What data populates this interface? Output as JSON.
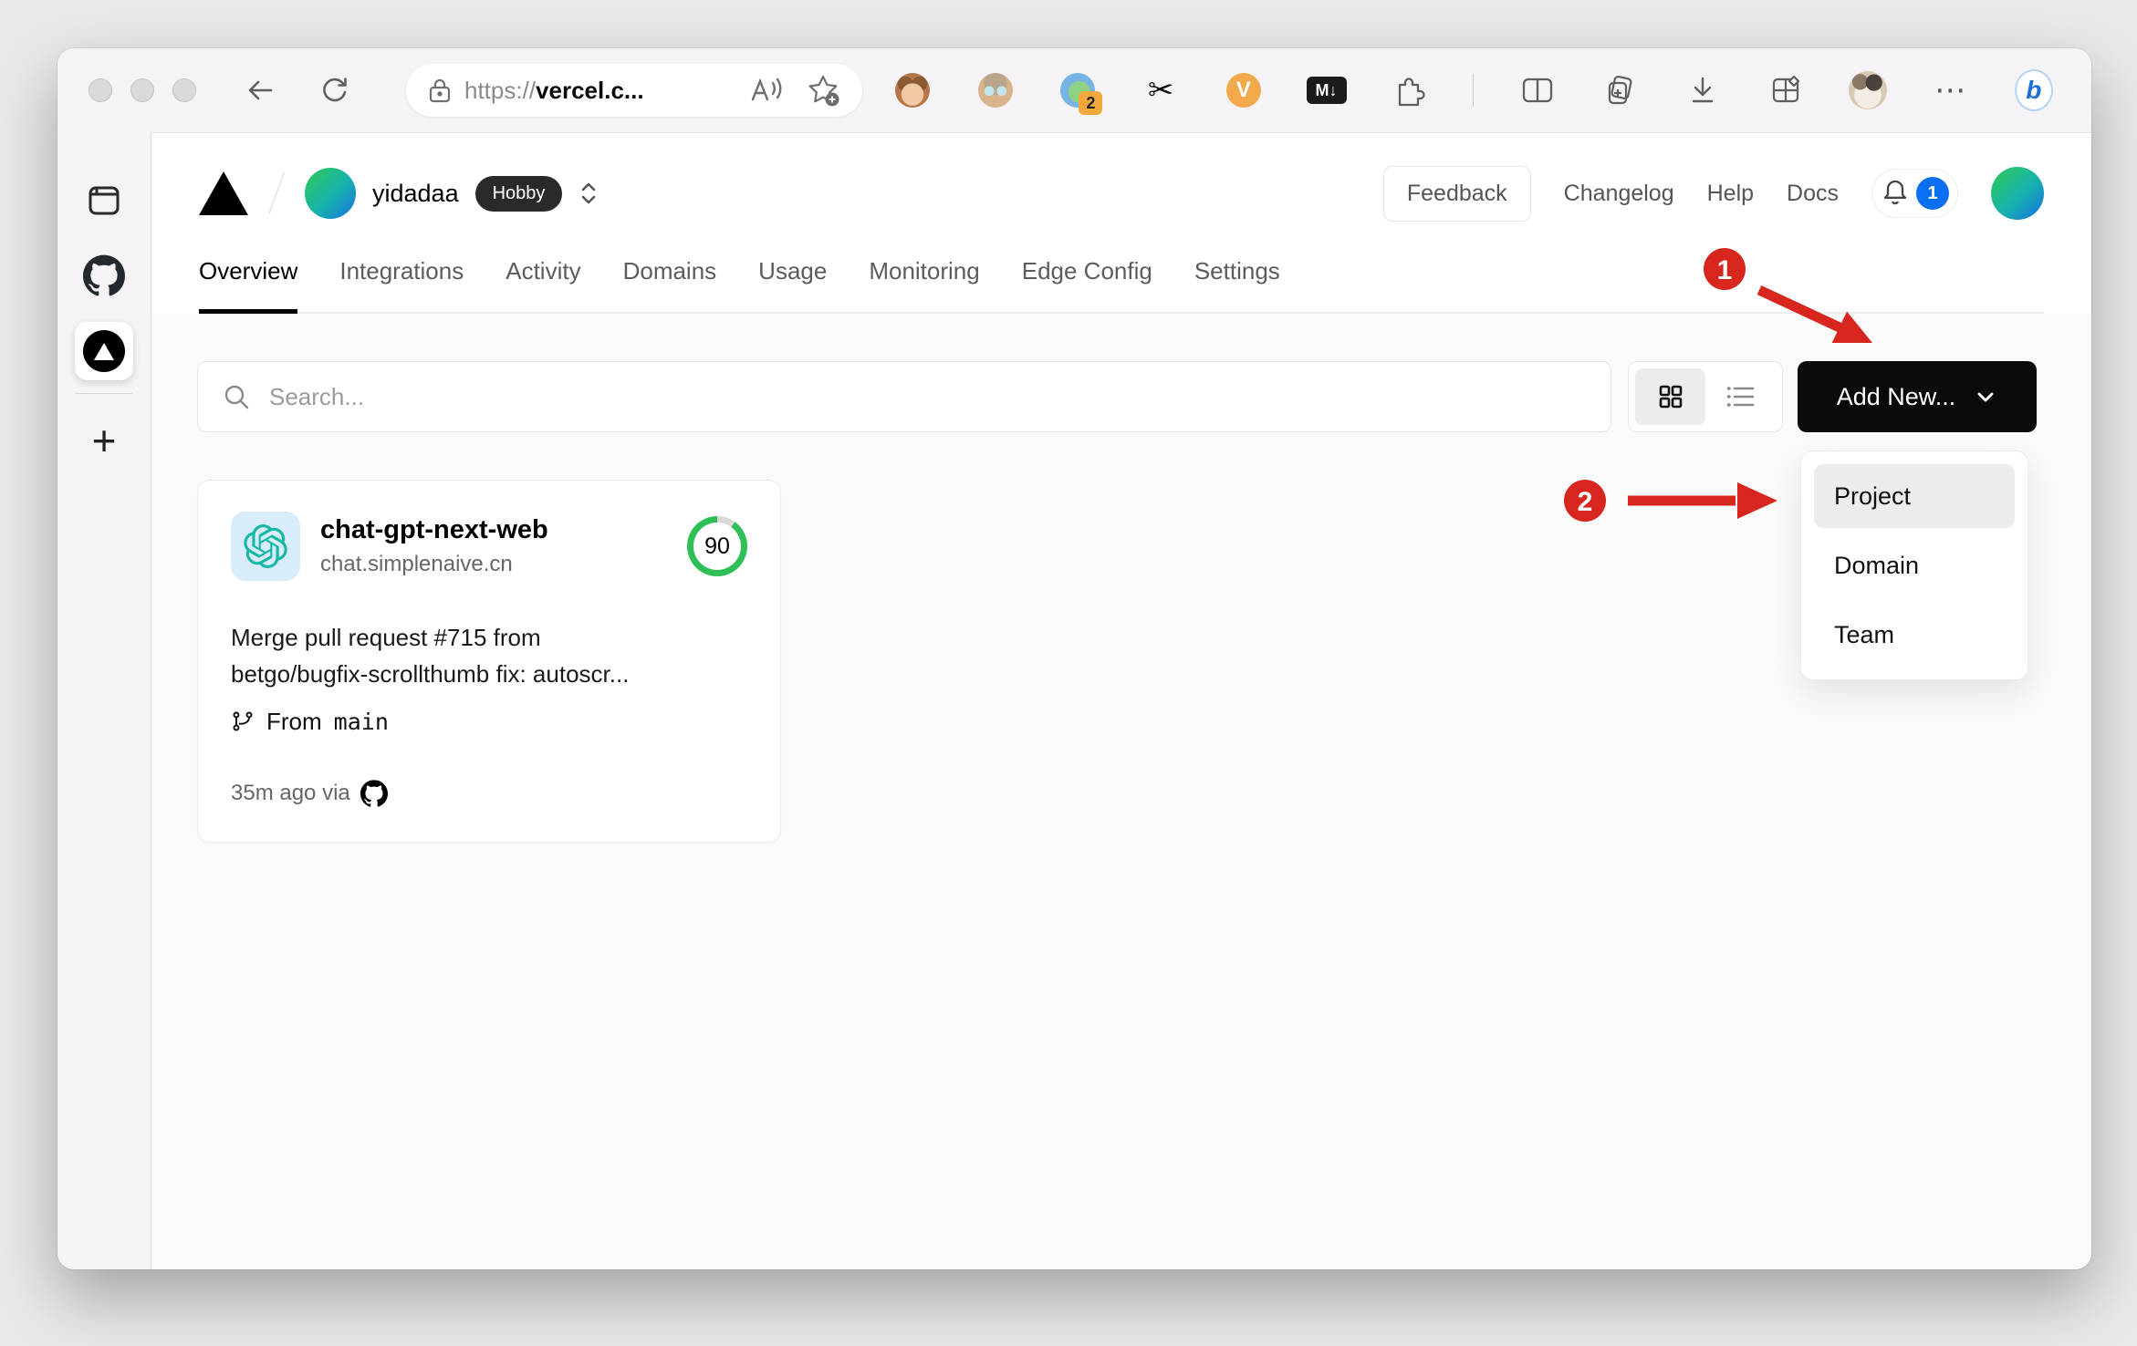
{
  "browser": {
    "url_scheme": "https://",
    "url_host": "vercel.c...",
    "extension_badge": "2"
  },
  "icons": {
    "scissors": "✂",
    "dots": "⋯",
    "v_label": "V",
    "markdown_label": "M↓",
    "plus": "+",
    "bing_label": "b"
  },
  "header": {
    "team": "yidadaa",
    "plan_badge": "Hobby",
    "feedback_label": "Feedback",
    "links": [
      "Changelog",
      "Help",
      "Docs"
    ],
    "notification_count": "1"
  },
  "tabs": {
    "items": [
      "Overview",
      "Integrations",
      "Activity",
      "Domains",
      "Usage",
      "Monitoring",
      "Edge Config",
      "Settings"
    ],
    "active": "Overview"
  },
  "toolbar": {
    "search_placeholder": "Search...",
    "add_new_label": "Add New..."
  },
  "dropdown": {
    "items": [
      "Project",
      "Domain",
      "Team"
    ],
    "highlighted": "Project"
  },
  "project_card": {
    "name": "chat-gpt-next-web",
    "domain": "chat.simplenaive.cn",
    "score": "90",
    "description_line1": "Merge pull request #715 from",
    "description_line2": "betgo/bugfix-scrollthumb fix: autoscr...",
    "from_label": "From",
    "branch": "main",
    "deployed": "35m ago via"
  },
  "annotations": {
    "step1": "1",
    "step2": "2"
  },
  "colors": {
    "accent_red": "#d7261e",
    "score_green": "#2fbf57",
    "badge_blue": "#0a6ff0",
    "add_new_black": "#0a0a0a"
  }
}
